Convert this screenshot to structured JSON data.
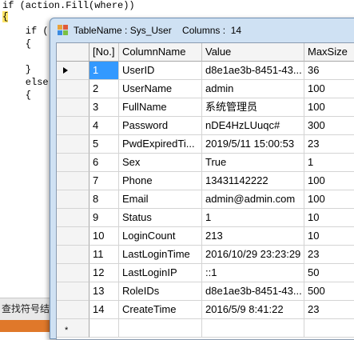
{
  "editor": {
    "lines": [
      "if (action.Fill(where))",
      "{",
      "    if (",
      "    {",
      "    }",
      "    else",
      "    {"
    ],
    "status_text": "查找符号结果"
  },
  "dialog": {
    "title": "TableName : Sys_User    Columns :  14",
    "icon": "table-grid-icon",
    "columns": [
      "[No.]",
      "ColumnName",
      "Value",
      "MaxSize"
    ],
    "rows": [
      {
        "no": "1",
        "name": "UserID",
        "value": "d8e1ae3b-8451-43...",
        "max": "36"
      },
      {
        "no": "2",
        "name": "UserName",
        "value": "admin",
        "max": "100"
      },
      {
        "no": "3",
        "name": "FullName",
        "value": "系统管理员",
        "max": "100"
      },
      {
        "no": "4",
        "name": "Password",
        "value": "nDE4HzLUuqc#",
        "max": "300"
      },
      {
        "no": "5",
        "name": "PwdExpiredTi...",
        "value": "2019/5/11 15:00:53",
        "max": "23"
      },
      {
        "no": "6",
        "name": "Sex",
        "value": "True",
        "max": "1"
      },
      {
        "no": "7",
        "name": "Phone",
        "value": "13431142222",
        "max": "100"
      },
      {
        "no": "8",
        "name": "Email",
        "value": "admin@admin.com",
        "max": "100"
      },
      {
        "no": "9",
        "name": "Status",
        "value": "1",
        "max": "10"
      },
      {
        "no": "10",
        "name": "LoginCount",
        "value": "213",
        "max": "10"
      },
      {
        "no": "11",
        "name": "LastLoginTime",
        "value": "2016/10/29 23:23:29",
        "max": "23"
      },
      {
        "no": "12",
        "name": "LastLoginIP",
        "value": "::1",
        "max": "50"
      },
      {
        "no": "13",
        "name": "RoleIDs",
        "value": "d8e1ae3b-8451-43...",
        "max": "500"
      },
      {
        "no": "14",
        "name": "CreateTime",
        "value": "2016/5/9 8:41:22",
        "max": "23"
      }
    ],
    "new_row_marker": "*"
  },
  "colors": {
    "selection": "#3399ff",
    "dialog_frame": "#cfe1f3",
    "brace_highlight": "#ffe566",
    "taskbar_accent": "#e0782a"
  }
}
